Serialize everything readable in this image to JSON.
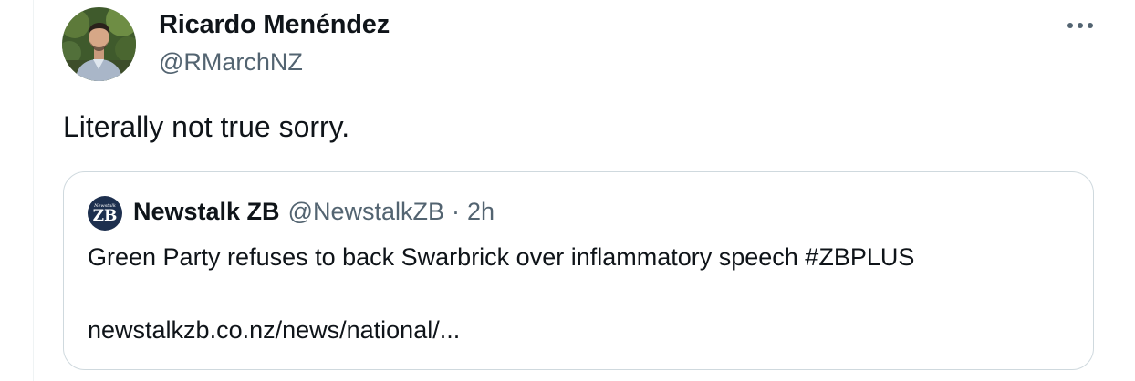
{
  "tweet": {
    "author": {
      "name": "Ricardo Menéndez",
      "handle": "@RMarchNZ"
    },
    "text": "Literally not true sorry.",
    "quoted": {
      "avatar_text_small": "Newstalk",
      "avatar_text_big": "ZB",
      "name": "Newstalk ZB",
      "handle": "@NewstalkZB",
      "separator": "·",
      "time": "2h",
      "text": "Green Party refuses to back Swarbrick over inflammatory speech #ZBPLUS",
      "link": "newstalkzb.co.nz/news/national/..."
    }
  },
  "icons": {
    "more": "more-horizontal-icon"
  },
  "colors": {
    "primary_text": "#0f1419",
    "secondary_text": "#536471",
    "border": "#cfd9de",
    "quote_avatar_bg": "#1d2f4e"
  }
}
